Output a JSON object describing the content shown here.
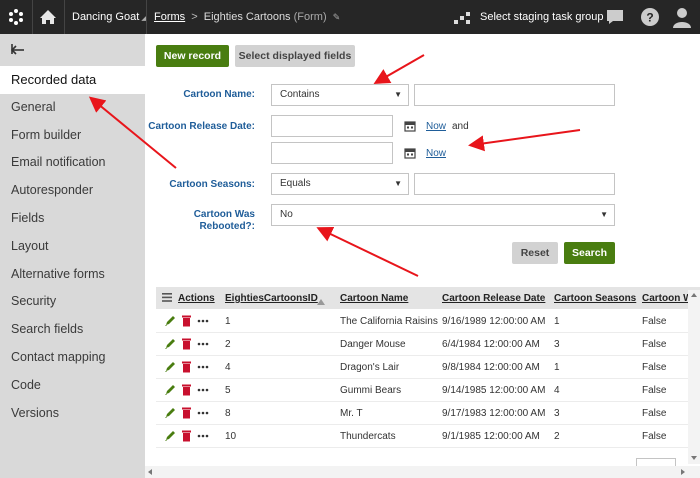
{
  "topbar": {
    "site_name": "Dancing Goat",
    "crumb_forms": "Forms",
    "crumb_separator": ">",
    "crumb_current": "Eighties Cartoons",
    "crumb_suffix": "(Form)",
    "staging_label": "Select staging task group",
    "icons": [
      "kentico-logo-icon",
      "home-icon",
      "pin-icon",
      "staging-icon",
      "chat-icon",
      "help-icon",
      "user-icon"
    ]
  },
  "sidebar": {
    "back_icon": "back-arrow-icon",
    "items": [
      {
        "label": "Recorded data",
        "active": true
      },
      {
        "label": "General"
      },
      {
        "label": "Form builder"
      },
      {
        "label": "Email notification"
      },
      {
        "label": "Autoresponder"
      },
      {
        "label": "Fields"
      },
      {
        "label": "Layout"
      },
      {
        "label": "Alternative forms"
      },
      {
        "label": "Security"
      },
      {
        "label": "Search fields"
      },
      {
        "label": "Contact mapping"
      },
      {
        "label": "Code"
      },
      {
        "label": "Versions"
      }
    ]
  },
  "toolbar": {
    "new_record": "New record",
    "select_fields": "Select displayed fields"
  },
  "filter": {
    "name_label": "Cartoon Name:",
    "name_operator": "Contains",
    "name_value": "",
    "release_label": "Cartoon Release Date:",
    "release_from": "",
    "release_to": "",
    "now_label": "Now",
    "and_label": "and",
    "seasons_label": "Cartoon Seasons:",
    "seasons_operator": "Equals",
    "seasons_value": "",
    "rebooted_label_1": "Cartoon Was",
    "rebooted_label_2": "Rebooted?:",
    "rebooted_value": "No",
    "reset_label": "Reset",
    "search_label": "Search"
  },
  "grid": {
    "columns": [
      "Actions",
      "EightiesCartoonsID",
      "Cartoon Name",
      "Cartoon Release Date",
      "Cartoon Seasons",
      "Cartoon W"
    ],
    "rows": [
      {
        "id": "1",
        "name": "The California Raisins",
        "date": "9/16/1989 12:00:00 AM",
        "seasons": "1",
        "rebooted": "False"
      },
      {
        "id": "2",
        "name": "Danger Mouse",
        "date": "6/4/1984 12:00:00 AM",
        "seasons": "3",
        "rebooted": "False"
      },
      {
        "id": "4",
        "name": "Dragon's Lair",
        "date": "9/8/1984 12:00:00 AM",
        "seasons": "1",
        "rebooted": "False"
      },
      {
        "id": "5",
        "name": "Gummi Bears",
        "date": "9/14/1985 12:00:00 AM",
        "seasons": "4",
        "rebooted": "False"
      },
      {
        "id": "8",
        "name": "Mr. T",
        "date": "9/17/1983 12:00:00 AM",
        "seasons": "3",
        "rebooted": "False"
      },
      {
        "id": "10",
        "name": "Thundercats",
        "date": "9/1/1985 12:00:00 AM",
        "seasons": "2",
        "rebooted": "False"
      }
    ],
    "action_icons": [
      "edit-icon",
      "delete-icon",
      "more-icon"
    ]
  },
  "colors": {
    "topbar": "#262626",
    "sidebar": "#d9d9d9",
    "primary_button": "#497d10",
    "label_blue": "#1f5d99",
    "annotation_red": "#e8151b"
  }
}
